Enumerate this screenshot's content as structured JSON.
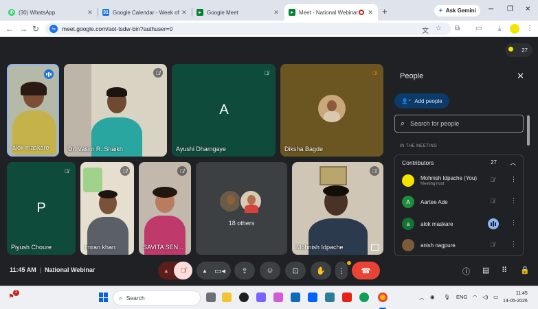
{
  "browser": {
    "tabs": [
      {
        "title": "(30) WhatsApp",
        "favicon": "whatsapp-icon",
        "color": "#25d366"
      },
      {
        "title": "Google Calendar - Week of Ma",
        "favicon": "calendar-icon",
        "color": "#1a73e8"
      },
      {
        "title": "Google Meet",
        "favicon": "meet-icon",
        "color": "#00832d"
      },
      {
        "title": "Meet - National Webinar",
        "favicon": "meet-icon",
        "color": "#00832d",
        "active": true
      }
    ],
    "gemini_label": "Ask Gemini",
    "url": "meet.google.com/aot-tsdw-bin?authuser=0"
  },
  "meet": {
    "participant_count": "27",
    "tiles": [
      {
        "name": "alok maskare",
        "state": "speaking"
      },
      {
        "name": "Dr. Vasim R. Shaikh",
        "state": "muted"
      },
      {
        "name": "Ayushi Dhamgaye",
        "letter": "A",
        "state": "muted"
      },
      {
        "name": "Diksha Bagde",
        "state": "muted"
      },
      {
        "name": "Piyush Choure",
        "letter": "P",
        "state": "muted"
      },
      {
        "name": "Imran khan",
        "state": "muted"
      },
      {
        "name": "SAVITA SEN...",
        "state": "muted"
      },
      {
        "name": "18 others"
      },
      {
        "name": "Mohnish Idpache",
        "state": "muted"
      }
    ],
    "time": "11:45 AM",
    "meeting_title": "National Webinar"
  },
  "people_panel": {
    "title": "People",
    "add_people_label": "Add people",
    "search_placeholder": "Search for people",
    "section_label": "IN THE MEETING",
    "group_label": "Contributors",
    "group_count": "27",
    "participants": [
      {
        "name": "Mohnish Idpache (You)",
        "sub": "Meeting host",
        "avatar_color": "#f2e500",
        "letter": "",
        "mic": "muted"
      },
      {
        "name": "Aartee Ade",
        "sub": "",
        "avatar_color": "#1e8e3e",
        "letter": "A",
        "mic": "muted"
      },
      {
        "name": "alok maskare",
        "sub": "",
        "avatar_color": "#137333",
        "letter": "a",
        "mic": "speaking"
      },
      {
        "name": "anish nagpure",
        "sub": "",
        "avatar_color": "#7a5c3a",
        "letter": "",
        "mic": "muted"
      }
    ]
  },
  "taskbar": {
    "search_label": "Search",
    "tray_lang": "ENG",
    "clock_time": "11:45",
    "clock_date": "14-05-2026",
    "notification_badge": "2"
  }
}
